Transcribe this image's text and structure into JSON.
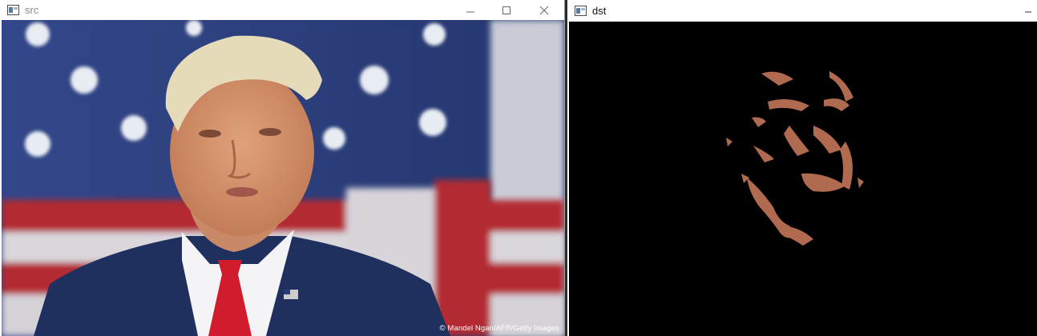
{
  "windows": [
    {
      "title": "src",
      "controls": [
        "minimize-icon",
        "maximize-icon",
        "close-icon"
      ],
      "image_credit": "© Mandel Ngan/AFP/Getty Images"
    },
    {
      "title": "dst",
      "controls": [
        "minimize-icon"
      ]
    }
  ],
  "colors": {
    "titlebar_bg": "#ffffff",
    "dst_background": "#000000",
    "skin_mask": "#b06a4f",
    "flag_blue": "#2a3d7a",
    "flag_red": "#b42a33",
    "suit": "#1f2f5e",
    "tie": "#d11c2e"
  }
}
